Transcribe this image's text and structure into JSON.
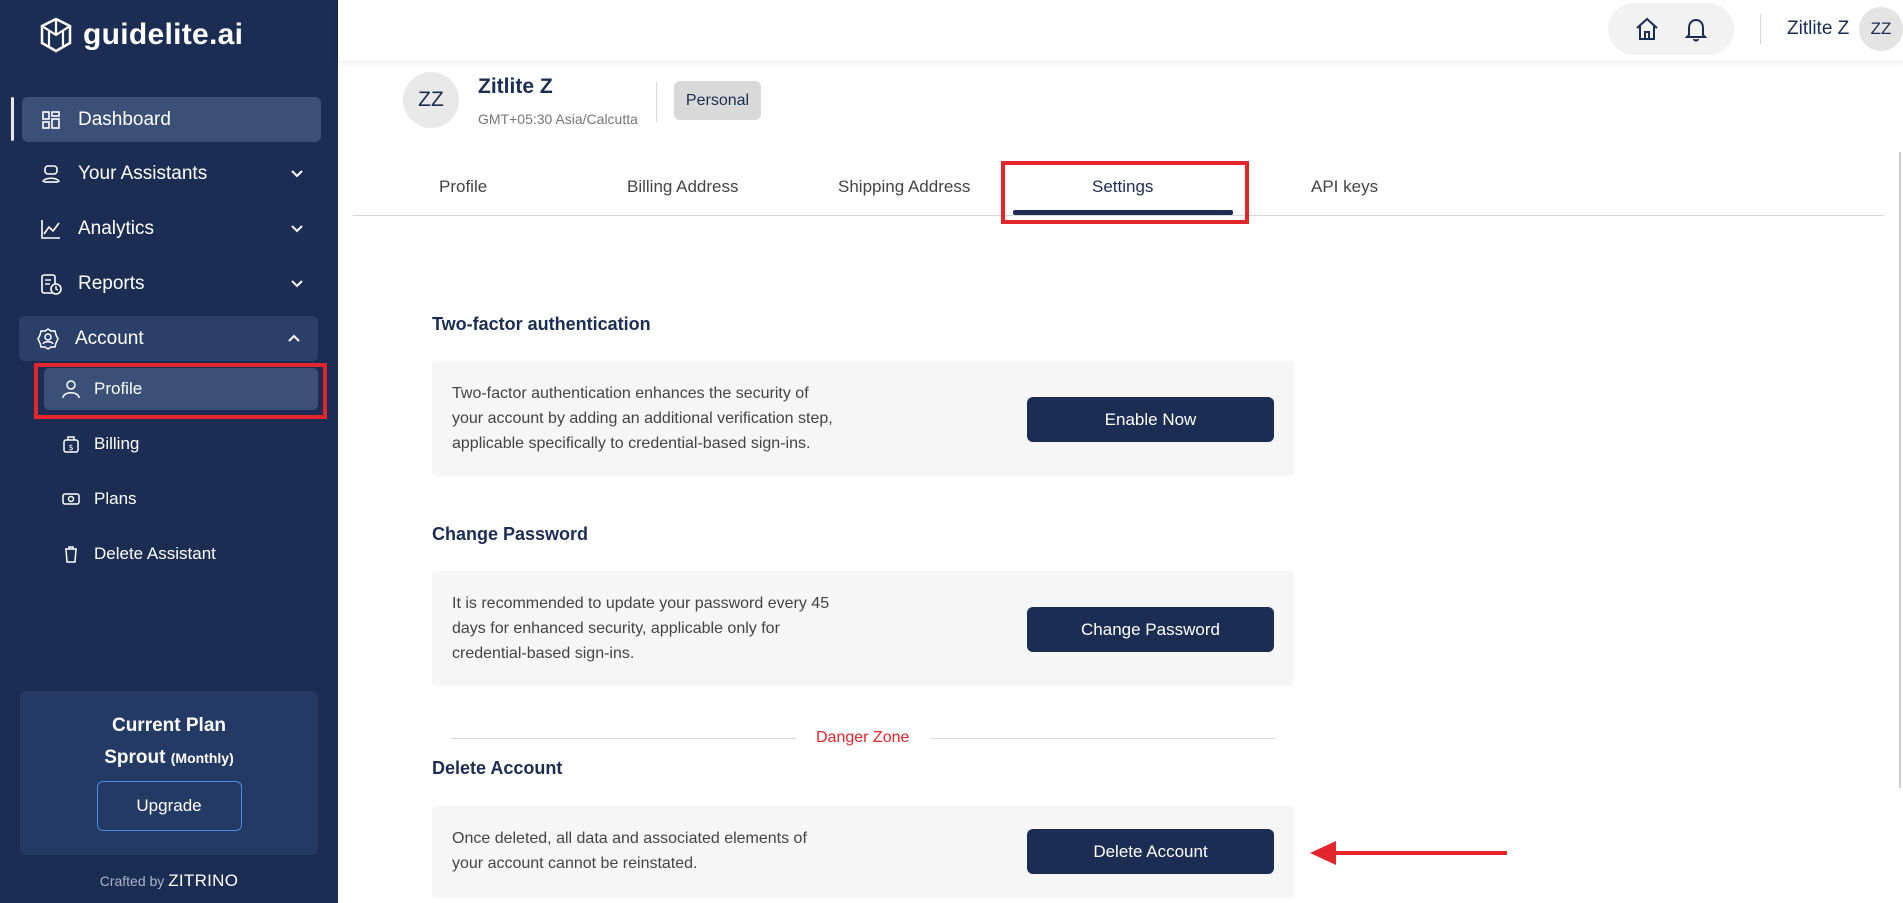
{
  "brand": {
    "name": "guidelite.ai"
  },
  "sidebar": {
    "items": [
      {
        "label": "Dashboard",
        "icon": "dashboard-icon"
      },
      {
        "label": "Your Assistants",
        "icon": "assistant-icon"
      },
      {
        "label": "Analytics",
        "icon": "analytics-icon"
      },
      {
        "label": "Reports",
        "icon": "reports-icon"
      },
      {
        "label": "Account",
        "icon": "account-gear-icon"
      }
    ],
    "account_sub": [
      {
        "label": "Profile",
        "icon": "user-icon"
      },
      {
        "label": "Billing",
        "icon": "billing-icon"
      },
      {
        "label": "Plans",
        "icon": "plans-icon"
      },
      {
        "label": "Delete Assistant",
        "icon": "trash-icon"
      }
    ],
    "plan": {
      "title": "Current Plan",
      "name": "Sprout",
      "period": "(Monthly)",
      "upgrade": "Upgrade"
    },
    "crafted_prefix": "Crafted by",
    "crafted_brand": "ZITRINO"
  },
  "header": {
    "user_name": "Zitlite Z",
    "user_initials": "ZZ"
  },
  "profile": {
    "initials": "ZZ",
    "name": "Zitlite Z",
    "timezone": "GMT+05:30 Asia/Calcutta",
    "badge": "Personal"
  },
  "tabs": [
    {
      "label": "Profile"
    },
    {
      "label": "Billing Address"
    },
    {
      "label": "Shipping Address"
    },
    {
      "label": "Settings"
    },
    {
      "label": "API keys"
    }
  ],
  "settings": {
    "two_factor": {
      "title": "Two-factor authentication",
      "line1": "Two-factor authentication enhances the security of",
      "line2": "your account by adding an additional verification step,",
      "line3": "applicable specifically to credential-based sign-ins.",
      "button": "Enable Now"
    },
    "password": {
      "title": "Change Password",
      "line1": "It is recommended to update your password every 45",
      "line2": "days for enhanced security, applicable only for",
      "line3": "credential-based sign-ins.",
      "button": "Change Password"
    },
    "danger_zone": "Danger Zone",
    "delete": {
      "title": "Delete Account",
      "line1": "Once deleted, all data and associated elements of",
      "line2": "your account cannot be reinstated.",
      "button": "Delete Account"
    }
  },
  "colors": {
    "navy": "#1b2d52",
    "highlight": "#e3262b",
    "danger": "#e3262b"
  }
}
